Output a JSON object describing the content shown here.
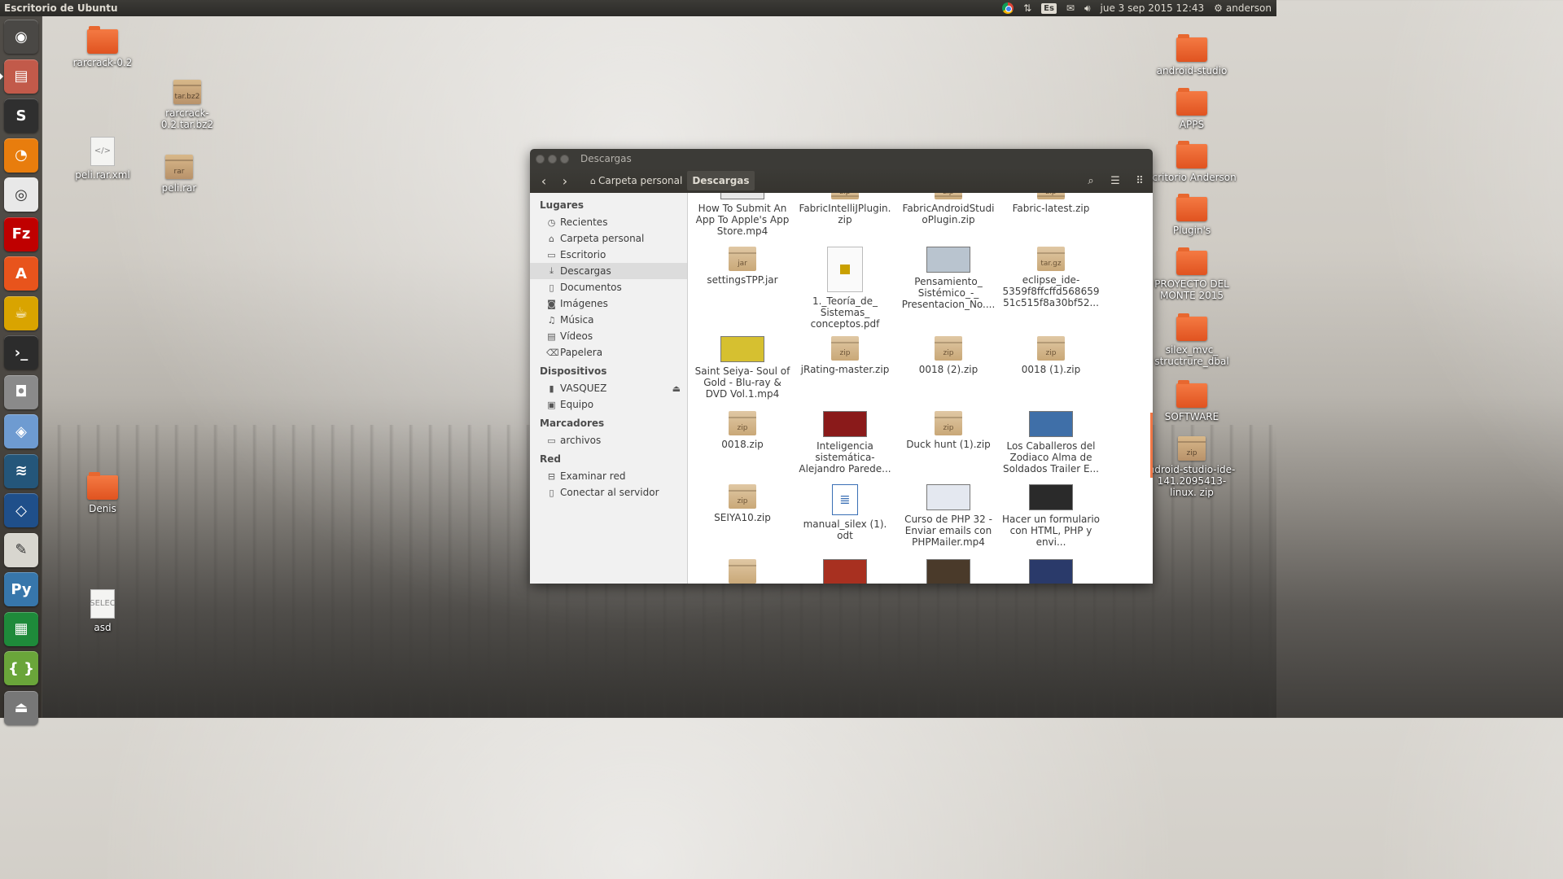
{
  "panel": {
    "title": "Escritorio de Ubuntu",
    "keyboard_layout": "Es",
    "datetime": "jue  3 sep 2015 12:43",
    "user": "anderson",
    "icons": [
      "chrome-icon",
      "network-transfer-icon",
      "keyboard-layout-icon",
      "mail-icon",
      "volume-icon",
      "gear-icon"
    ]
  },
  "launcher": {
    "items": [
      "dash-home-icon",
      "files-icon",
      "sublime-text-icon",
      "blender-icon",
      "chrome-icon",
      "filezilla-icon",
      "software-center-icon",
      "teapot-icon",
      "terminal-icon",
      "camera-icon",
      "cube-icon",
      "mysql-workbench-icon",
      "virtualbox-icon",
      "text-editor-icon",
      "python-icon",
      "spreadsheet-icon",
      "brackets-icon",
      "usb-drive-icon"
    ],
    "colors": [
      "#4a4845",
      "#c25a4a",
      "#2f2f2f",
      "#e87d0d",
      "#e8e8e8",
      "#bf0000",
      "#e8541c",
      "#d9a400",
      "#2c2c2c",
      "#8a8a8a",
      "#6e9bd1",
      "#24567a",
      "#1f4f8a",
      "#d8d6cf",
      "#3776ab",
      "#1e8a3a",
      "#6aa53a",
      "#777777"
    ]
  },
  "desktop_left": [
    {
      "label": "rarcrack-0.2",
      "kind": "folder"
    },
    {
      "label": "rarcrack-0.2.tar.bz2",
      "kind": "archive",
      "badge": "tar.bz2"
    },
    {
      "label": "peli.rar.xml",
      "kind": "text",
      "glyph": "</>"
    },
    {
      "label": "peli.rar",
      "kind": "archive",
      "badge": "rar"
    },
    {
      "label": "Denis",
      "kind": "folder"
    },
    {
      "label": "asd",
      "kind": "text",
      "glyph": "SELEC"
    }
  ],
  "desktop_right": [
    {
      "label": "android-studio",
      "kind": "folder"
    },
    {
      "label": "APPS",
      "kind": "folder"
    },
    {
      "label": "scritorio Anderson",
      "kind": "folder"
    },
    {
      "label": "Plugin's",
      "kind": "folder"
    },
    {
      "label": "PROYECTO DEL MONTE 2015",
      "kind": "folder"
    },
    {
      "label": "silex_mvc_ structrure_dbal",
      "kind": "folder"
    },
    {
      "label": "SOFTWARE",
      "kind": "folder"
    },
    {
      "label": "ndroid-studio-ide-141.2095413-linux. zip",
      "kind": "archive",
      "badge": "zip"
    }
  ],
  "window": {
    "title": "Descargas",
    "breadcrumb_home": "Carpeta personal",
    "breadcrumb_current": "Descargas",
    "sidebar": {
      "sections": [
        {
          "heading": "Lugares",
          "items": [
            {
              "label": "Recientes",
              "icon": "clock-icon"
            },
            {
              "label": "Carpeta personal",
              "icon": "home-icon"
            },
            {
              "label": "Escritorio",
              "icon": "folder-icon"
            },
            {
              "label": "Descargas",
              "icon": "download-icon"
            },
            {
              "label": "Documentos",
              "icon": "document-icon"
            },
            {
              "label": "Imágenes",
              "icon": "camera-icon"
            },
            {
              "label": "Música",
              "icon": "music-icon"
            },
            {
              "label": "Vídeos",
              "icon": "film-icon"
            },
            {
              "label": "Papelera",
              "icon": "trash-icon"
            }
          ]
        },
        {
          "heading": "Dispositivos",
          "items": [
            {
              "label": "VASQUEZ",
              "icon": "usb-icon"
            },
            {
              "label": "Equipo",
              "icon": "computer-icon"
            }
          ]
        },
        {
          "heading": "Marcadores",
          "items": [
            {
              "label": "archivos",
              "icon": "folder-icon"
            }
          ]
        },
        {
          "heading": "Red",
          "items": [
            {
              "label": "Examinar red",
              "icon": "network-icon"
            },
            {
              "label": "Conectar al servidor",
              "icon": "server-icon"
            }
          ]
        }
      ]
    },
    "files": [
      {
        "name": "How To Submit An App To Apple's App Store.mp4",
        "kind": "video",
        "thumb": "#e8e8e8"
      },
      {
        "name": "FabricIntelliJPlugin. zip",
        "kind": "zip",
        "badge": "zip"
      },
      {
        "name": "FabricAndroidStudi oPlugin.zip",
        "kind": "zip",
        "badge": "zip"
      },
      {
        "name": "Fabric-latest.zip",
        "kind": "zip",
        "badge": "zip"
      },
      {
        "name": "settingsTPP.jar",
        "kind": "zip",
        "badge": "jar"
      },
      {
        "name": "1._Teoría_de_ Sistemas_ conceptos.pdf",
        "kind": "pdf"
      },
      {
        "name": "Pensamiento_ Sistémico_-_ Presentacion_No....",
        "kind": "video",
        "thumb": "#b9c4cf"
      },
      {
        "name": "eclipse_ide- 5359f8ffcffd568659 51c515f8a30bf52...",
        "kind": "zip",
        "badge": "tar.gz"
      },
      {
        "name": "Saint Seiya- Soul of Gold - Blu-ray & DVD Vol.1.mp4",
        "kind": "video",
        "thumb": "#d6c030"
      },
      {
        "name": "jRating-master.zip",
        "kind": "zip",
        "badge": "zip"
      },
      {
        "name": "0018 (2).zip",
        "kind": "zip",
        "badge": "zip"
      },
      {
        "name": "0018 (1).zip",
        "kind": "zip",
        "badge": "zip"
      },
      {
        "name": "0018.zip",
        "kind": "zip",
        "badge": "zip"
      },
      {
        "name": "Inteligencia sistemática- Alejandro Parede...",
        "kind": "video",
        "thumb": "#8a1a1a"
      },
      {
        "name": "Duck hunt (1).zip",
        "kind": "zip",
        "badge": "zip"
      },
      {
        "name": "Los Caballeros del Zodiaco Alma de Soldados Trailer E...",
        "kind": "video",
        "thumb": "#3f6fa8"
      },
      {
        "name": "SEIYA10.zip",
        "kind": "zip",
        "badge": "zip"
      },
      {
        "name": "manual_silex (1). odt",
        "kind": "odt"
      },
      {
        "name": "Curso de PHP 32 - Enviar emails con PHPMailer.mp4",
        "kind": "video",
        "thumb": "#e4e8f0"
      },
      {
        "name": "Hacer un formulario con HTML, PHP y envi...",
        "kind": "video",
        "thumb": "#2a2a2a"
      },
      {
        "name": "",
        "kind": "zip",
        "badge": ""
      },
      {
        "name": "",
        "kind": "video",
        "thumb": "#a83020"
      },
      {
        "name": "",
        "kind": "video",
        "thumb": "#4a3a2a"
      },
      {
        "name": "",
        "kind": "video",
        "thumb": "#2a3a6a"
      }
    ]
  },
  "colors": {
    "panel_bg": "#3c3b37",
    "folder_orange": "#e05320",
    "selection_gray": "#dcdcdc",
    "scroll_accent": "#f07746"
  }
}
